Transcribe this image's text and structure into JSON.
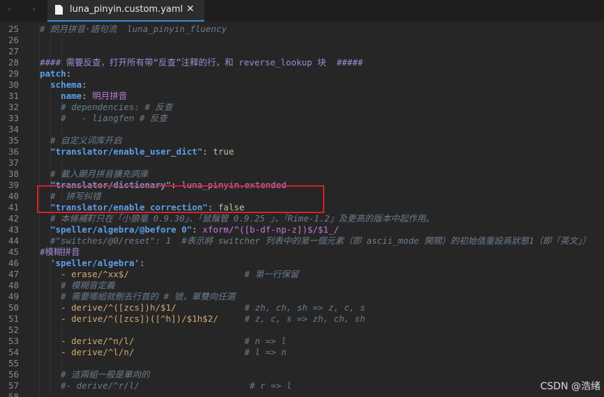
{
  "tab": {
    "title": "luna_pinyin.custom.yaml",
    "close": "✕"
  },
  "nav": {
    "back": "‹",
    "forward": "›"
  },
  "watermark": "CSDN @浩绪",
  "lines": [
    {
      "n": "25",
      "t": [
        [
          "c",
          "# 朗月拼音·語句流  luna_pinyin_fluency"
        ]
      ]
    },
    {
      "n": "26",
      "t": []
    },
    {
      "n": "27",
      "t": []
    },
    {
      "n": "28",
      "t": [
        [
          "ch",
          "#### 需要反查，打开所有带“反查”注释的行，和 reverse_lookup 块  #####"
        ]
      ]
    },
    {
      "n": "29",
      "t": [
        [
          "k",
          "patch"
        ],
        [
          "p",
          ":"
        ]
      ]
    },
    {
      "n": "30",
      "t": [
        [
          "p",
          "  "
        ],
        [
          "k",
          "schema"
        ],
        [
          "p",
          ":"
        ]
      ]
    },
    {
      "n": "31",
      "t": [
        [
          "p",
          "    "
        ],
        [
          "k",
          "name"
        ],
        [
          "p",
          ": "
        ],
        [
          "s",
          "明月拼音"
        ]
      ]
    },
    {
      "n": "32",
      "t": [
        [
          "c",
          "    # dependencies: # 反查"
        ]
      ]
    },
    {
      "n": "33",
      "t": [
        [
          "c",
          "    #   - liangfen # 反查"
        ]
      ]
    },
    {
      "n": "34",
      "t": []
    },
    {
      "n": "35",
      "t": [
        [
          "c",
          "  # 自定义词库开启"
        ]
      ]
    },
    {
      "n": "36",
      "t": [
        [
          "p",
          "  "
        ],
        [
          "k",
          "\"translator/enable_user_dict\""
        ],
        [
          "p",
          ": "
        ],
        [
          "b",
          "true"
        ]
      ]
    },
    {
      "n": "37",
      "t": []
    },
    {
      "n": "38",
      "t": [
        [
          "c",
          "  # 載入朙月拼音擴充詞庫"
        ]
      ]
    },
    {
      "n": "39",
      "t": [
        [
          "p",
          "  "
        ],
        [
          "k",
          "\"translator/dictionary\""
        ],
        [
          "p",
          ": "
        ],
        [
          "s",
          "luna_pinyin.extended"
        ]
      ]
    },
    {
      "n": "40",
      "t": [
        [
          "c",
          "  #  拼写纠错"
        ]
      ]
    },
    {
      "n": "41",
      "t": [
        [
          "p",
          "  "
        ],
        [
          "k",
          "\"translator/enable_correction\""
        ],
        [
          "p",
          ": "
        ],
        [
          "b",
          "false"
        ]
      ]
    },
    {
      "n": "42",
      "t": [
        [
          "c",
          "  # 本條補靪只在「小狼毫 0.9.30」、「鼠鬚管 0.9.25 」、「Rime-1.2」及更高的版本中起作用。"
        ]
      ]
    },
    {
      "n": "43",
      "t": [
        [
          "p",
          "  "
        ],
        [
          "k",
          "\"speller/algebra/@before 0\""
        ],
        [
          "p",
          ": "
        ],
        [
          "rx",
          "xform/^([b-df-np-z])$/$1_/"
        ]
      ]
    },
    {
      "n": "44",
      "t": [
        [
          "c",
          "  #\"switches/@0/reset\": 1  #表示將 switcher 列表中的第一個元素（即 ascii_mode 開關）的初始值重設爲狀態1（即「英文」）"
        ]
      ]
    },
    {
      "n": "45",
      "t": [
        [
          "ch",
          "#模糊拼音"
        ]
      ]
    },
    {
      "n": "46",
      "t": [
        [
          "p",
          "  "
        ],
        [
          "k",
          "'speller/algebra'"
        ],
        [
          "p",
          ":"
        ]
      ]
    },
    {
      "n": "47",
      "t": [
        [
          "p",
          "    "
        ],
        [
          "f",
          "- erase/^xx$/"
        ],
        [
          "c",
          "                      # 第一行保留"
        ]
      ]
    },
    {
      "n": "48",
      "t": [
        [
          "c",
          "    # 模糊音定義"
        ]
      ]
    },
    {
      "n": "49",
      "t": [
        [
          "c",
          "    # 需要哪組就刪去行首的 # 號，單雙向任選"
        ]
      ]
    },
    {
      "n": "50",
      "t": [
        [
          "p",
          "    "
        ],
        [
          "f",
          "- derive/^([zcs])h/$1/"
        ],
        [
          "c",
          "             # zh, ch, sh => z, c, s"
        ]
      ]
    },
    {
      "n": "51",
      "t": [
        [
          "p",
          "    "
        ],
        [
          "f",
          "- derive/^([zcs])([^h])/$1h$2/"
        ],
        [
          "c",
          "     # z, c, s => zh, ch, sh"
        ]
      ]
    },
    {
      "n": "52",
      "t": []
    },
    {
      "n": "53",
      "t": [
        [
          "p",
          "    "
        ],
        [
          "f",
          "- derive/^n/l/"
        ],
        [
          "c",
          "                     # n => l"
        ]
      ]
    },
    {
      "n": "54",
      "t": [
        [
          "p",
          "    "
        ],
        [
          "f",
          "- derive/^l/n/"
        ],
        [
          "c",
          "                     # l => n"
        ]
      ]
    },
    {
      "n": "55",
      "t": []
    },
    {
      "n": "56",
      "t": [
        [
          "c",
          "    # 這兩組一般是單向的"
        ]
      ]
    },
    {
      "n": "57",
      "t": [
        [
          "c",
          "    #- derive/^r/l/                     # r => l"
        ]
      ]
    },
    {
      "n": "58",
      "t": []
    }
  ]
}
